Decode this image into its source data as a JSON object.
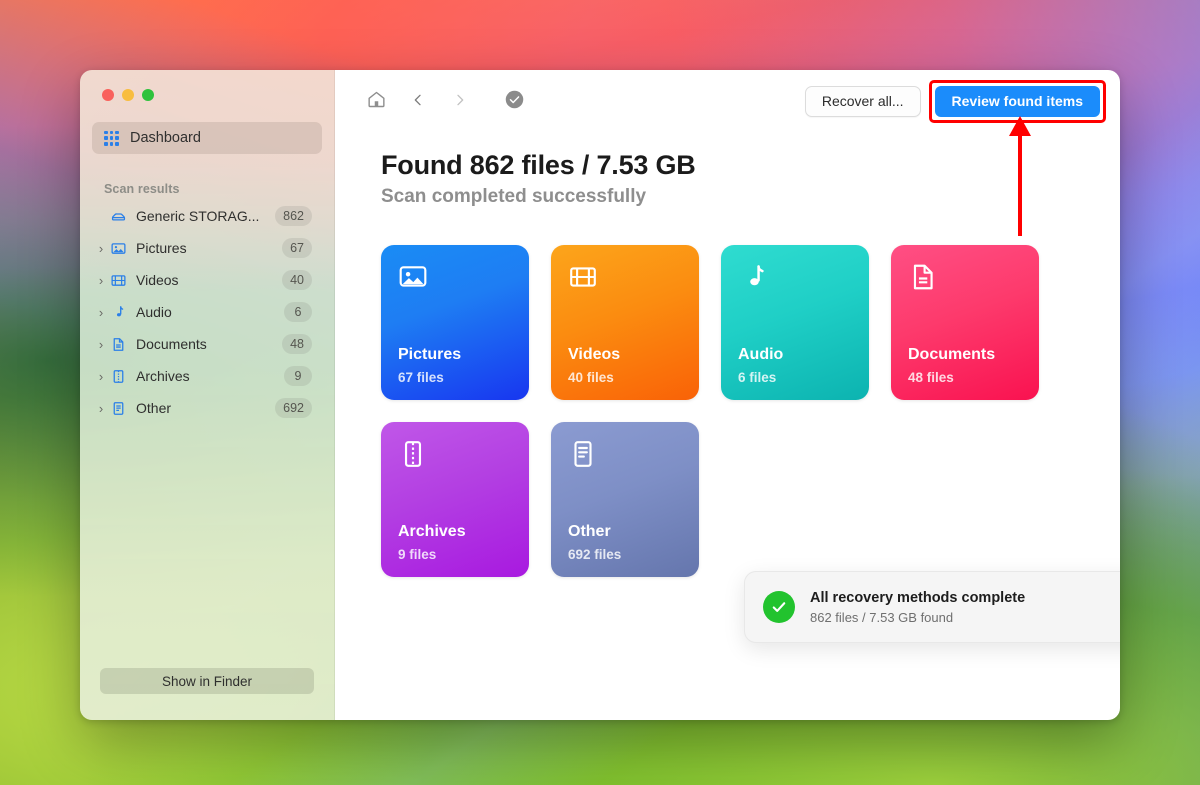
{
  "window": {
    "traffic_lights": {
      "close": "close",
      "minimize": "minimize",
      "zoom": "zoom"
    }
  },
  "sidebar": {
    "dashboard": {
      "label": "Dashboard",
      "icon": "grid-icon"
    },
    "section_title": "Scan results",
    "items": [
      {
        "label": "Generic STORAG...",
        "count": "862",
        "icon": "drive-icon",
        "expandable": false
      },
      {
        "label": "Pictures",
        "count": "67",
        "icon": "picture-icon",
        "expandable": true
      },
      {
        "label": "Videos",
        "count": "40",
        "icon": "film-icon",
        "expandable": true
      },
      {
        "label": "Audio",
        "count": "6",
        "icon": "music-note-icon",
        "expandable": true
      },
      {
        "label": "Documents",
        "count": "48",
        "icon": "document-icon",
        "expandable": true
      },
      {
        "label": "Archives",
        "count": "9",
        "icon": "archive-icon",
        "expandable": true
      },
      {
        "label": "Other",
        "count": "692",
        "icon": "other-file-icon",
        "expandable": true
      }
    ],
    "chevron": "›",
    "footer_button": "Show in Finder"
  },
  "toolbar": {
    "home_icon": "home-icon",
    "back_icon": "chevron-left-icon",
    "forward_icon": "chevron-right-icon",
    "status_icon": "check-circle-icon",
    "recover_all_label": "Recover all...",
    "review_label": "Review found items",
    "primary_color": "#1b8cfb"
  },
  "main": {
    "title": "Found 862 files / 7.53 GB",
    "subtitle": "Scan completed successfully",
    "cards": [
      {
        "name": "Pictures",
        "count": "67 files",
        "icon": "picture-icon",
        "accent": "#1e7df3",
        "class": "c-pictures"
      },
      {
        "name": "Videos",
        "count": "40 files",
        "icon": "film-icon",
        "accent": "#fb8c10",
        "class": "c-videos"
      },
      {
        "name": "Audio",
        "count": "6 files",
        "icon": "music-note-icon",
        "accent": "#1fcfc6",
        "class": "c-audio"
      },
      {
        "name": "Documents",
        "count": "48 files",
        "icon": "document-icon",
        "accent": "#fd3a6c",
        "class": "c-documents"
      },
      {
        "name": "Archives",
        "count": "9 files",
        "icon": "archive-icon",
        "accent": "#b33fe2",
        "class": "c-archives"
      },
      {
        "name": "Other",
        "count": "692 files",
        "icon": "other-file-icon",
        "accent": "#7e8fc6",
        "class": "c-other"
      }
    ]
  },
  "toast": {
    "icon": "success-check-icon",
    "title": "All recovery methods complete",
    "subtitle": "862 files / 7.53 GB found",
    "close_label": "×"
  },
  "annotation": {
    "highlight_color": "#ff0000",
    "target": "Review found items"
  }
}
